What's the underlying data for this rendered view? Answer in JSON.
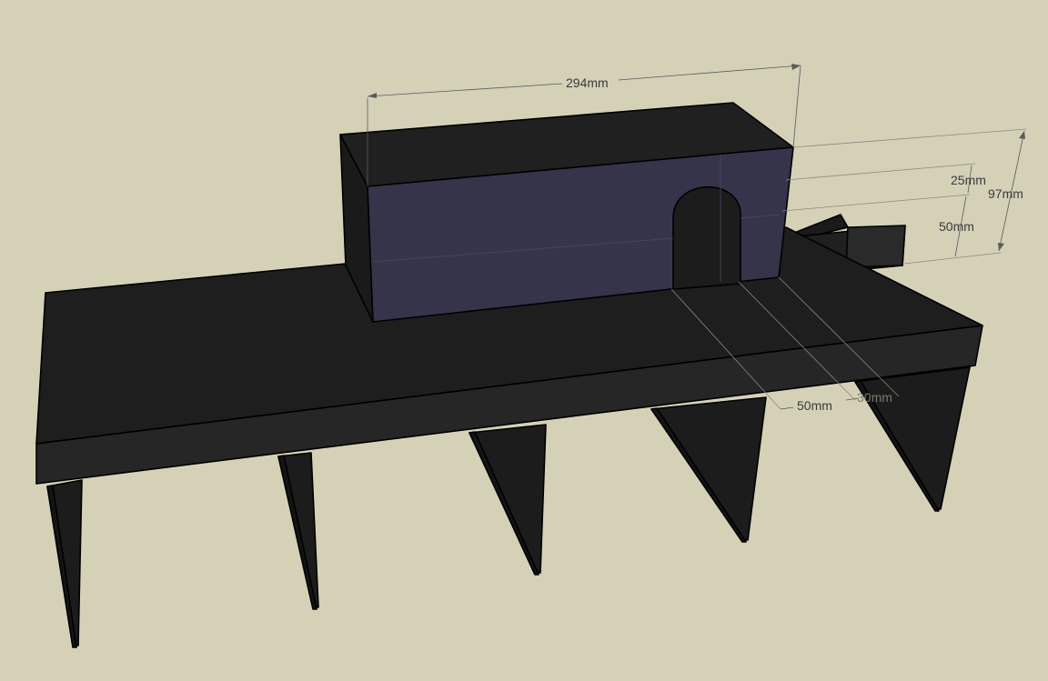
{
  "dimensions": {
    "width_top": "294mm",
    "height_arch_top": "25mm",
    "height_total": "97mm",
    "height_arch": "50mm",
    "depth_a": "50mm",
    "depth_b": "30mm"
  },
  "colors": {
    "background": "#d4d1b7",
    "solid_dark": "#1e1e1e",
    "box_interior": "#35344a",
    "dimension_line": "#5a5a5a"
  }
}
